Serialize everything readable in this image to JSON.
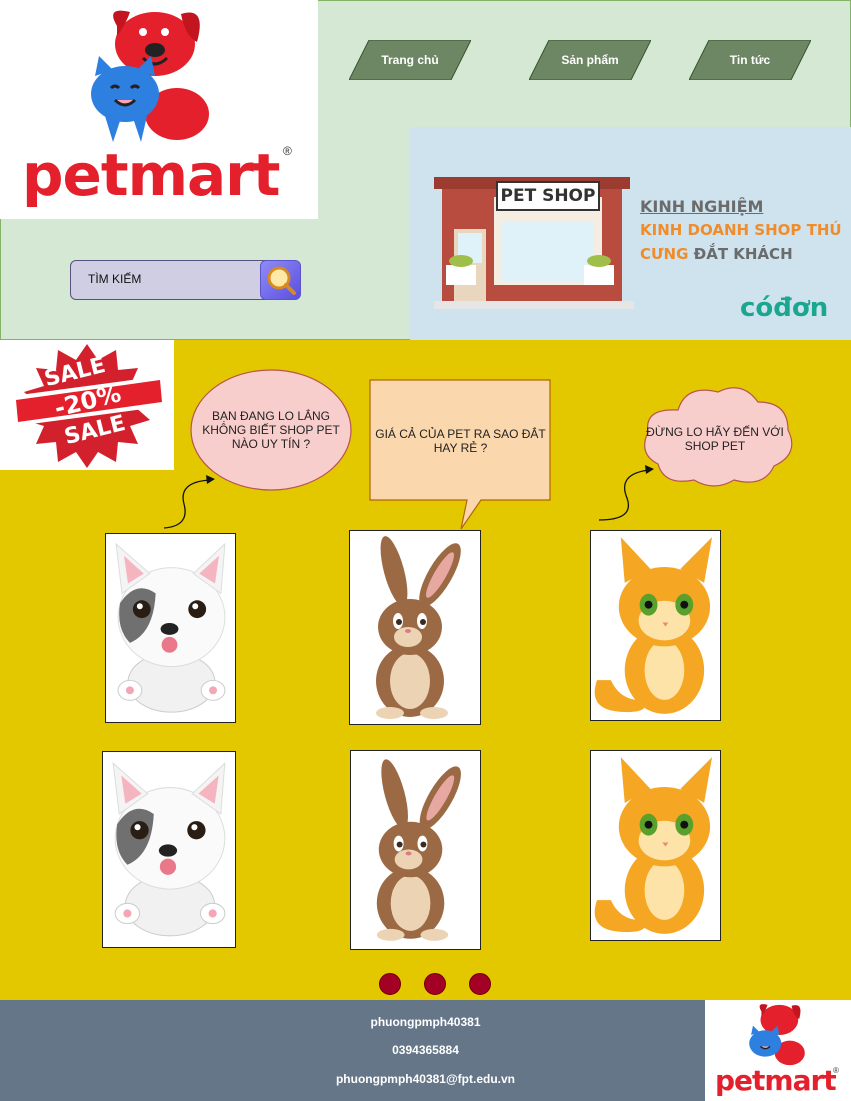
{
  "brand": {
    "name_part1": "pet",
    "name_part2": "mart",
    "registered": "®"
  },
  "nav": [
    {
      "label": "Trang chủ"
    },
    {
      "label": "Sản phẩm"
    },
    {
      "label": "Tin tức"
    }
  ],
  "search": {
    "label": "TÌM KIẾM"
  },
  "banner": {
    "shop_sign": "PET SHOP",
    "line1": "KINH NGHIỆM",
    "line2": "KINH DOANH SHOP THÚ",
    "line3_a": "CƯNG",
    "line3_b": "ĐẮT KHÁCH",
    "brand": "cóđơn"
  },
  "sale": {
    "top": "SALE",
    "discount": "-20%",
    "bottom": "SALE"
  },
  "bubbles": {
    "worry": "BẠN ĐANG LO LẮNG KHÔNG BIẾT SHOP PET NÀO UY TÍN ?",
    "price": "GIÁ CẢ CỦA PET RA SAO ĐẮT HAY RẺ ?",
    "cloud": "ĐỪNG LO HÃY ĐẾN VỚI SHOP PET"
  },
  "products": [
    {
      "animal": "dog"
    },
    {
      "animal": "rabbit"
    },
    {
      "animal": "cat"
    },
    {
      "animal": "dog"
    },
    {
      "animal": "rabbit"
    },
    {
      "animal": "cat"
    }
  ],
  "pagination": {
    "count": 3
  },
  "footer": {
    "name": "phuongpmph40381",
    "phone": "0394365884",
    "email": "phuongpmph40381@fpt.edu.vn"
  },
  "colors": {
    "header_bg": "#d5e8d4",
    "nav_button": "#6d8764",
    "main_bg": "#e3c800",
    "footer_bg": "#647687",
    "dot": "#a20025",
    "brand_red": "#e3202b",
    "brand_blue": "#2d7fe0"
  }
}
